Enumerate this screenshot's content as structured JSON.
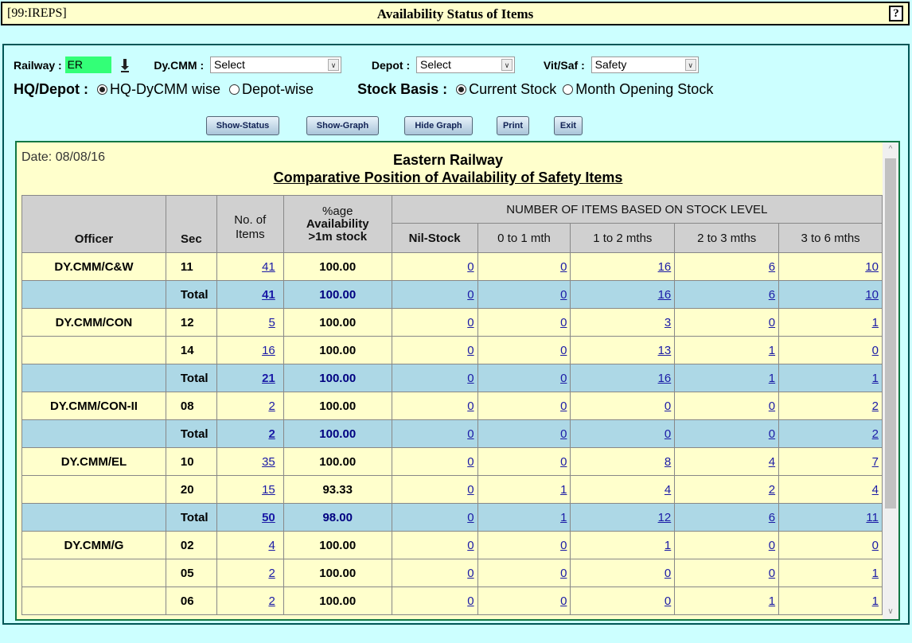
{
  "window": {
    "code": "[99:IREPS]",
    "title": "Availability Status of Items",
    "help": "?"
  },
  "filters": {
    "railway_label": "Railway :",
    "railway_value": "ER",
    "dycmm_label": "Dy.CMM :",
    "dycmm_value": "Select",
    "depot_label": "Depot :",
    "depot_value": "Select",
    "vitsaf_label": "Vit/Saf :",
    "vitsaf_value": "Safety"
  },
  "options": {
    "hq_label": "HQ/Depot :",
    "hq_opt1": "HQ-DyCMM wise",
    "hq_opt2": "Depot-wise",
    "stock_label": "Stock Basis :",
    "stock_opt1": "Current Stock",
    "stock_opt2": "Month Opening Stock"
  },
  "buttons": {
    "show_status": "Show-Status",
    "show_graph": "Show-Graph",
    "hide_graph": "Hide Graph",
    "print": "Print",
    "exit": "Exit"
  },
  "report": {
    "date": "Date: 08/08/16",
    "org": "Eastern Railway",
    "title": "Comparative Position of Availability of Safety Items"
  },
  "table": {
    "headers": {
      "officer": "Officer",
      "sec": "Sec",
      "items1": "No. of",
      "items2": "Items",
      "pct1": "%age",
      "pct2": "Availability",
      "pct3": ">1m stock",
      "group": "NUMBER OF ITEMS BASED ON STOCK LEVEL",
      "nil": "Nil-Stock",
      "m01": "0 to 1 mth",
      "m12": "1 to 2 mths",
      "m23": "2 to 3 mths",
      "m36": "3 to 6 mths"
    },
    "rows": [
      {
        "officer": "DY.CMM/C&W",
        "sec": "11",
        "items": "41",
        "pct": "100.00",
        "nil": "0",
        "m01": "0",
        "m12": "16",
        "m23": "6",
        "m36": "10",
        "total": false
      },
      {
        "officer": "",
        "sec": "Total",
        "items": "41",
        "pct": "100.00",
        "nil": "0",
        "m01": "0",
        "m12": "16",
        "m23": "6",
        "m36": "10",
        "total": true
      },
      {
        "officer": "DY.CMM/CON",
        "sec": "12",
        "items": "5",
        "pct": "100.00",
        "nil": "0",
        "m01": "0",
        "m12": "3",
        "m23": "0",
        "m36": "1",
        "total": false
      },
      {
        "officer": "",
        "sec": "14",
        "items": "16",
        "pct": "100.00",
        "nil": "0",
        "m01": "0",
        "m12": "13",
        "m23": "1",
        "m36": "0",
        "total": false
      },
      {
        "officer": "",
        "sec": "Total",
        "items": "21",
        "pct": "100.00",
        "nil": "0",
        "m01": "0",
        "m12": "16",
        "m23": "1",
        "m36": "1",
        "total": true
      },
      {
        "officer": "DY.CMM/CON-II",
        "sec": "08",
        "items": "2",
        "pct": "100.00",
        "nil": "0",
        "m01": "0",
        "m12": "0",
        "m23": "0",
        "m36": "2",
        "total": false
      },
      {
        "officer": "",
        "sec": "Total",
        "items": "2",
        "pct": "100.00",
        "nil": "0",
        "m01": "0",
        "m12": "0",
        "m23": "0",
        "m36": "2",
        "total": true
      },
      {
        "officer": "DY.CMM/EL",
        "sec": "10",
        "items": "35",
        "pct": "100.00",
        "nil": "0",
        "m01": "0",
        "m12": "8",
        "m23": "4",
        "m36": "7",
        "total": false
      },
      {
        "officer": "",
        "sec": "20",
        "items": "15",
        "pct": "93.33",
        "nil": "0",
        "m01": "1",
        "m12": "4",
        "m23": "2",
        "m36": "4",
        "total": false
      },
      {
        "officer": "",
        "sec": "Total",
        "items": "50",
        "pct": "98.00",
        "nil": "0",
        "m01": "1",
        "m12": "12",
        "m23": "6",
        "m36": "11",
        "total": true
      },
      {
        "officer": "DY.CMM/G",
        "sec": "02",
        "items": "4",
        "pct": "100.00",
        "nil": "0",
        "m01": "0",
        "m12": "1",
        "m23": "0",
        "m36": "0",
        "total": false
      },
      {
        "officer": "",
        "sec": "05",
        "items": "2",
        "pct": "100.00",
        "nil": "0",
        "m01": "0",
        "m12": "0",
        "m23": "0",
        "m36": "1",
        "total": false
      },
      {
        "officer": "",
        "sec": "06",
        "items": "2",
        "pct": "100.00",
        "nil": "0",
        "m01": "0",
        "m12": "0",
        "m23": "1",
        "m36": "1",
        "total": false
      }
    ]
  }
}
